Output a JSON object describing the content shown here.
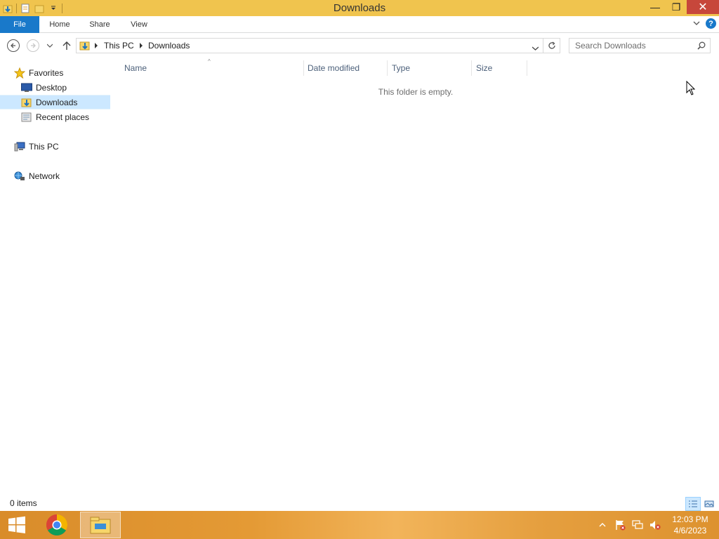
{
  "window": {
    "title": "Downloads",
    "minimize_glyph": "—",
    "restore_glyph": "❐",
    "close_glyph": "✕"
  },
  "ribbon": {
    "tabs": [
      {
        "label": "File"
      },
      {
        "label": "Home"
      },
      {
        "label": "Share"
      },
      {
        "label": "View"
      }
    ],
    "help_glyph": "?"
  },
  "address": {
    "crumbs": [
      "This PC",
      "Downloads"
    ],
    "search_placeholder": "Search Downloads"
  },
  "navpane": {
    "favorites": "Favorites",
    "desktop": "Desktop",
    "downloads": "Downloads",
    "recent": "Recent places",
    "thispc": "This PC",
    "network": "Network"
  },
  "content": {
    "columns": [
      "Name",
      "Date modified",
      "Type",
      "Size"
    ],
    "sort_glyph": "^",
    "empty_message": "This folder is empty."
  },
  "status": {
    "item_count": "0 items"
  },
  "taskbar": {
    "time": "12:03 PM",
    "date": "4/6/2023"
  },
  "colors": {
    "titlebar": "#f0c44e",
    "file_tab": "#1979ca",
    "selection": "#cce8ff",
    "taskbar": "#e49a35"
  }
}
